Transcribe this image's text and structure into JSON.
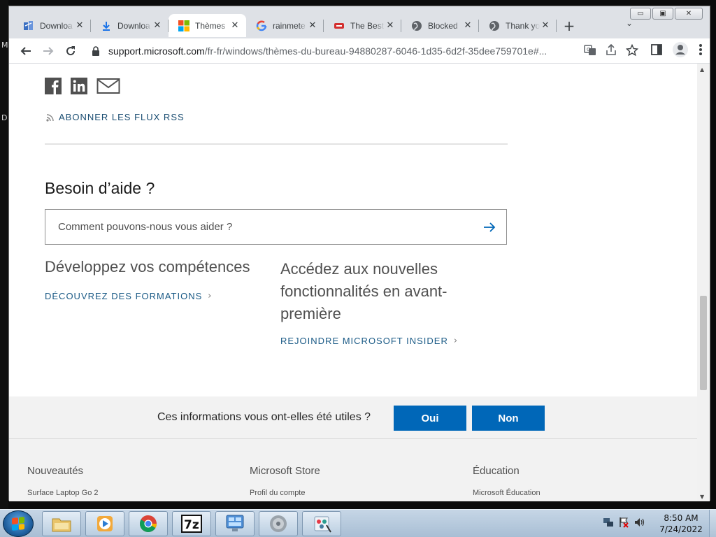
{
  "desktop": {
    "edge_letters": [
      "M",
      "D"
    ]
  },
  "browser": {
    "window_controls": {
      "minimize": "▭",
      "maximize": "▣",
      "close": "✕"
    },
    "tabs": [
      {
        "title": "Downloa",
        "icon": "download-site-icon"
      },
      {
        "title": "Downloa",
        "icon": "download-arrow-icon"
      },
      {
        "title": "Thèmes",
        "icon": "microsoft-logo-icon",
        "active": true
      },
      {
        "title": "rainmete",
        "icon": "google-g-icon"
      },
      {
        "title": "The Best",
        "icon": "video-site-icon"
      },
      {
        "title": "Blocked",
        "icon": "globe-icon"
      },
      {
        "title": "Thank yo",
        "icon": "globe-icon"
      }
    ],
    "new_tab": "+",
    "tab_search": "⌄",
    "address": {
      "host": "support.microsoft.com",
      "path": "/fr-fr/windows/thèmes-du-bureau-94880287-6046-1d35-6d2f-35dee759701e#..."
    }
  },
  "page": {
    "rss_label": "ABONNER LES FLUX RSS",
    "help_title": "Besoin d’aide ?",
    "help_search_placeholder": "Comment pouvons-nous vous aider ?",
    "skills_title": "Développez vos compétences",
    "skills_link": "DÉCOUVREZ DES FORMATIONS",
    "insider_title": "Accédez aux nouvelles fonctionnalités en avant-première",
    "insider_link": "REJOINDRE MICROSOFT INSIDER",
    "feedback_question": "Ces informations vous ont-elles été utiles ?",
    "feedback_yes": "Oui",
    "feedback_no": "Non",
    "footer": [
      {
        "heading": "Nouveautés",
        "item": "Surface Laptop Go 2"
      },
      {
        "heading": "Microsoft Store",
        "item": "Profil du compte"
      },
      {
        "heading": "Éducation",
        "item": "Microsoft Éducation"
      }
    ]
  },
  "taskbar": {
    "clock_time": "8:50 AM",
    "clock_date": "7/24/2022",
    "apps": [
      "file-explorer-icon",
      "media-player-icon",
      "chrome-icon",
      "7zip-icon",
      "control-panel-icon",
      "speaker-app-icon",
      "paint-icon"
    ]
  },
  "colors": {
    "link": "#1a5a86",
    "primary_button": "#0067b8",
    "tabbar": "#dee1e6"
  }
}
